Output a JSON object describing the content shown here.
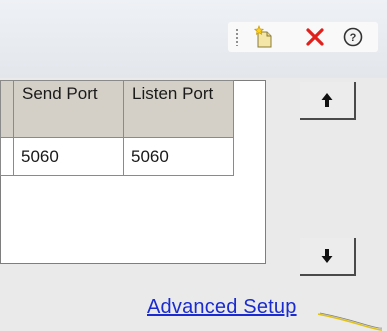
{
  "toolbar": {
    "items": [
      {
        "icon": "new-item-icon"
      },
      {
        "icon": "delete-icon",
        "color": "#e0201a"
      },
      {
        "icon": "help-icon"
      }
    ]
  },
  "grid": {
    "columns": [
      {
        "label": ""
      },
      {
        "label": "Send Port"
      },
      {
        "label": "Listen Port"
      }
    ],
    "rows": [
      {
        "stub": "",
        "send_port": "5060",
        "listen_port": "5060"
      }
    ]
  },
  "buttons": {
    "move_up_icon": "arrow-up-icon",
    "move_down_icon": "arrow-down-icon"
  },
  "links": {
    "advanced_setup": "Advanced Setup",
    "color": "#1a2bd0"
  }
}
